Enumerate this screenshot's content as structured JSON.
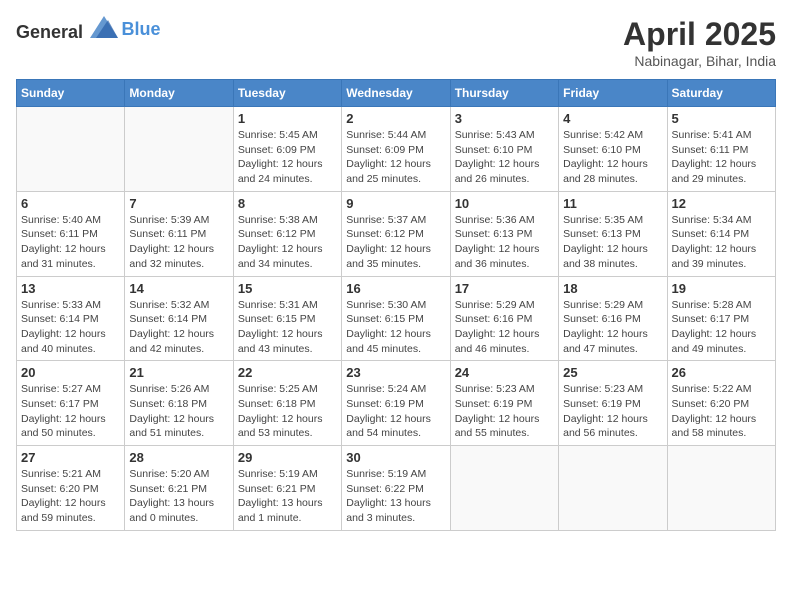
{
  "header": {
    "logo_general": "General",
    "logo_blue": "Blue",
    "month_title": "April 2025",
    "location": "Nabinagar, Bihar, India"
  },
  "days_of_week": [
    "Sunday",
    "Monday",
    "Tuesday",
    "Wednesday",
    "Thursday",
    "Friday",
    "Saturday"
  ],
  "weeks": [
    [
      {
        "day": "",
        "info": ""
      },
      {
        "day": "",
        "info": ""
      },
      {
        "day": "1",
        "info": "Sunrise: 5:45 AM\nSunset: 6:09 PM\nDaylight: 12 hours and 24 minutes."
      },
      {
        "day": "2",
        "info": "Sunrise: 5:44 AM\nSunset: 6:09 PM\nDaylight: 12 hours and 25 minutes."
      },
      {
        "day": "3",
        "info": "Sunrise: 5:43 AM\nSunset: 6:10 PM\nDaylight: 12 hours and 26 minutes."
      },
      {
        "day": "4",
        "info": "Sunrise: 5:42 AM\nSunset: 6:10 PM\nDaylight: 12 hours and 28 minutes."
      },
      {
        "day": "5",
        "info": "Sunrise: 5:41 AM\nSunset: 6:11 PM\nDaylight: 12 hours and 29 minutes."
      }
    ],
    [
      {
        "day": "6",
        "info": "Sunrise: 5:40 AM\nSunset: 6:11 PM\nDaylight: 12 hours and 31 minutes."
      },
      {
        "day": "7",
        "info": "Sunrise: 5:39 AM\nSunset: 6:11 PM\nDaylight: 12 hours and 32 minutes."
      },
      {
        "day": "8",
        "info": "Sunrise: 5:38 AM\nSunset: 6:12 PM\nDaylight: 12 hours and 34 minutes."
      },
      {
        "day": "9",
        "info": "Sunrise: 5:37 AM\nSunset: 6:12 PM\nDaylight: 12 hours and 35 minutes."
      },
      {
        "day": "10",
        "info": "Sunrise: 5:36 AM\nSunset: 6:13 PM\nDaylight: 12 hours and 36 minutes."
      },
      {
        "day": "11",
        "info": "Sunrise: 5:35 AM\nSunset: 6:13 PM\nDaylight: 12 hours and 38 minutes."
      },
      {
        "day": "12",
        "info": "Sunrise: 5:34 AM\nSunset: 6:14 PM\nDaylight: 12 hours and 39 minutes."
      }
    ],
    [
      {
        "day": "13",
        "info": "Sunrise: 5:33 AM\nSunset: 6:14 PM\nDaylight: 12 hours and 40 minutes."
      },
      {
        "day": "14",
        "info": "Sunrise: 5:32 AM\nSunset: 6:14 PM\nDaylight: 12 hours and 42 minutes."
      },
      {
        "day": "15",
        "info": "Sunrise: 5:31 AM\nSunset: 6:15 PM\nDaylight: 12 hours and 43 minutes."
      },
      {
        "day": "16",
        "info": "Sunrise: 5:30 AM\nSunset: 6:15 PM\nDaylight: 12 hours and 45 minutes."
      },
      {
        "day": "17",
        "info": "Sunrise: 5:29 AM\nSunset: 6:16 PM\nDaylight: 12 hours and 46 minutes."
      },
      {
        "day": "18",
        "info": "Sunrise: 5:29 AM\nSunset: 6:16 PM\nDaylight: 12 hours and 47 minutes."
      },
      {
        "day": "19",
        "info": "Sunrise: 5:28 AM\nSunset: 6:17 PM\nDaylight: 12 hours and 49 minutes."
      }
    ],
    [
      {
        "day": "20",
        "info": "Sunrise: 5:27 AM\nSunset: 6:17 PM\nDaylight: 12 hours and 50 minutes."
      },
      {
        "day": "21",
        "info": "Sunrise: 5:26 AM\nSunset: 6:18 PM\nDaylight: 12 hours and 51 minutes."
      },
      {
        "day": "22",
        "info": "Sunrise: 5:25 AM\nSunset: 6:18 PM\nDaylight: 12 hours and 53 minutes."
      },
      {
        "day": "23",
        "info": "Sunrise: 5:24 AM\nSunset: 6:19 PM\nDaylight: 12 hours and 54 minutes."
      },
      {
        "day": "24",
        "info": "Sunrise: 5:23 AM\nSunset: 6:19 PM\nDaylight: 12 hours and 55 minutes."
      },
      {
        "day": "25",
        "info": "Sunrise: 5:23 AM\nSunset: 6:19 PM\nDaylight: 12 hours and 56 minutes."
      },
      {
        "day": "26",
        "info": "Sunrise: 5:22 AM\nSunset: 6:20 PM\nDaylight: 12 hours and 58 minutes."
      }
    ],
    [
      {
        "day": "27",
        "info": "Sunrise: 5:21 AM\nSunset: 6:20 PM\nDaylight: 12 hours and 59 minutes."
      },
      {
        "day": "28",
        "info": "Sunrise: 5:20 AM\nSunset: 6:21 PM\nDaylight: 13 hours and 0 minutes."
      },
      {
        "day": "29",
        "info": "Sunrise: 5:19 AM\nSunset: 6:21 PM\nDaylight: 13 hours and 1 minute."
      },
      {
        "day": "30",
        "info": "Sunrise: 5:19 AM\nSunset: 6:22 PM\nDaylight: 13 hours and 3 minutes."
      },
      {
        "day": "",
        "info": ""
      },
      {
        "day": "",
        "info": ""
      },
      {
        "day": "",
        "info": ""
      }
    ]
  ]
}
